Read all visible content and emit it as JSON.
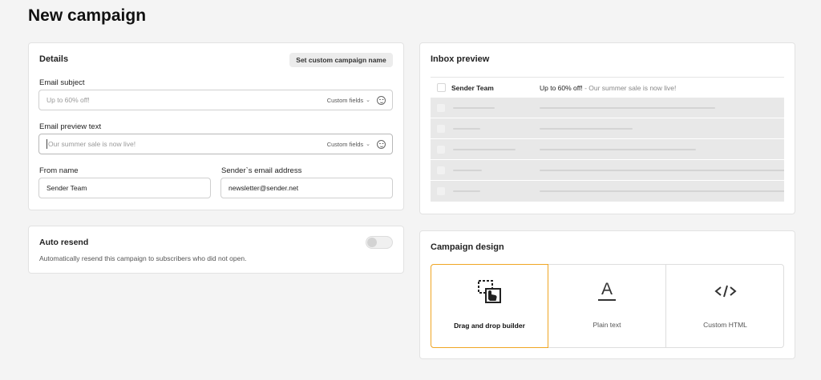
{
  "page": {
    "title": "New campaign"
  },
  "details": {
    "title": "Details",
    "custom_name_button": "Set custom campaign name",
    "email_subject": {
      "label": "Email subject",
      "placeholder": "Up to 60% off!",
      "custom_fields": "Custom fields"
    },
    "email_preview": {
      "label": "Email preview text",
      "placeholder": "Our summer sale is now live!",
      "custom_fields": "Custom fields"
    },
    "from_name": {
      "label": "From name",
      "value": "Sender Team"
    },
    "sender_email": {
      "label": "Sender`s email address",
      "value": "newsletter@sender.net"
    }
  },
  "auto_resend": {
    "title": "Auto resend",
    "description": "Automatically resend this campaign to subscribers who did not open.",
    "enabled": false
  },
  "inbox_preview": {
    "title": "Inbox preview",
    "sender": "Sender Team",
    "subject": "Up to 60% off!",
    "separator": " - ",
    "preview": "Our summer sale is now live!"
  },
  "campaign_design": {
    "title": "Campaign design",
    "options": [
      {
        "label": "Drag and drop builder",
        "icon": "drag-drop-icon",
        "selected": true
      },
      {
        "label": "Plain text",
        "icon": "text-format-icon",
        "selected": false
      },
      {
        "label": "Custom HTML",
        "icon": "code-icon",
        "selected": false
      }
    ],
    "accent": "#f0a623"
  }
}
